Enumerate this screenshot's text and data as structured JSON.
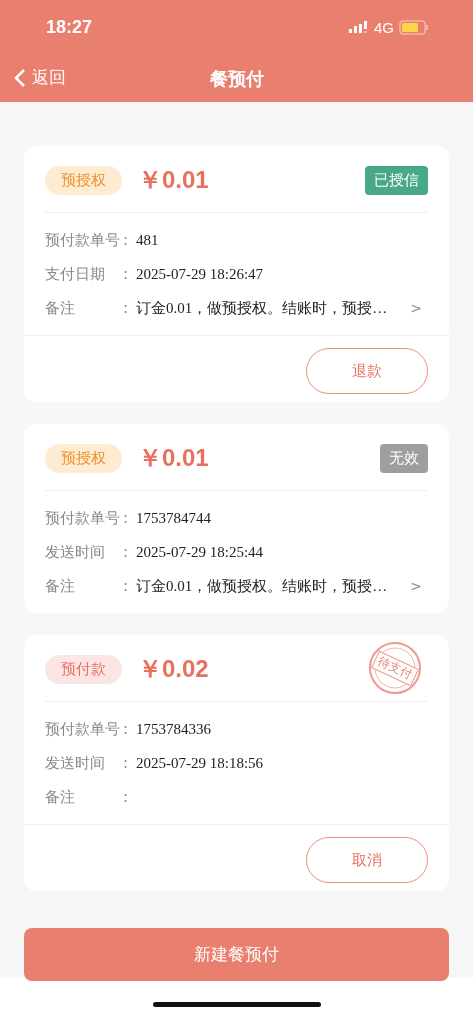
{
  "status_bar": {
    "time": "18:27",
    "network": "4G"
  },
  "nav": {
    "back": "返回",
    "title": "餐预付"
  },
  "cards": [
    {
      "tag": {
        "kind": "preauth",
        "label": "预授权"
      },
      "amount": "￥0.01",
      "status": {
        "kind": "badge",
        "label": "已授信",
        "color": "#4aa88a"
      },
      "fields": [
        {
          "label": "预付款单号",
          "colon": ":",
          "value": "481"
        },
        {
          "label": "支付日期",
          "colon": ":",
          "value": "2025-07-29 18:26:47"
        },
        {
          "label": "备注",
          "colon": ":",
          "value": "订金0.01，做预授权。结账时，预授…",
          "more": ">"
        }
      ],
      "action": "退款"
    },
    {
      "tag": {
        "kind": "preauth",
        "label": "预授权"
      },
      "amount": "￥0.01",
      "status": {
        "kind": "badge",
        "label": "无效",
        "color": "#9e9e9e"
      },
      "fields": [
        {
          "label": "预付款单号",
          "colon": ":",
          "value": "1753784744"
        },
        {
          "label": "发送时间",
          "colon": ":",
          "value": "2025-07-29 18:25:44"
        },
        {
          "label": "备注",
          "colon": ":",
          "value": "订金0.01，做预授权。结账时，预授…",
          "more": ">"
        }
      ]
    },
    {
      "tag": {
        "kind": "prepay",
        "label": "预付款"
      },
      "amount": "￥0.02",
      "status": {
        "kind": "stamp",
        "label": "待支付"
      },
      "fields": [
        {
          "label": "预付款单号",
          "colon": ":",
          "value": "1753784336"
        },
        {
          "label": "发送时间",
          "colon": ":",
          "value": "2025-07-29 18:18:56"
        },
        {
          "label": "备注",
          "colon": ":"
        }
      ],
      "action": "取消"
    }
  ],
  "primary_button": "新建餐预付"
}
